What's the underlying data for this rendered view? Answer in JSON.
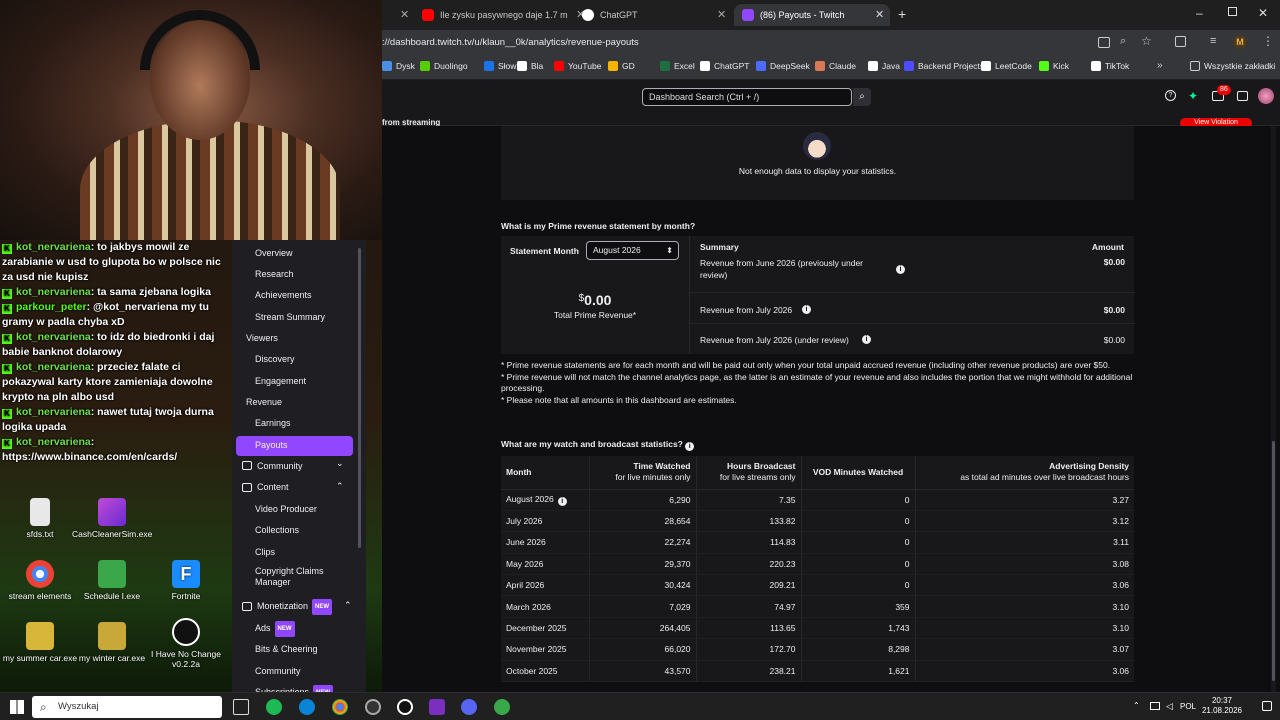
{
  "browser": {
    "tabs": [
      {
        "label": "Ile zysku pasywnego daje 1.7 m",
        "icon": "youtube-icon"
      },
      {
        "label": "ChatGPT",
        "icon": "chatgpt-icon"
      },
      {
        "label": "(86) Payouts - Twitch",
        "icon": "twitch-icon"
      }
    ],
    "url": "://dashboard.twitch.tv/u/klaun__0k/analytics/revenue-payouts",
    "bookmarks": [
      "Dysk",
      "Duolingo",
      "Słownik",
      "Bla",
      "YouTube",
      "GD",
      "Excel",
      "ChatGPT",
      "DeepSeek",
      "Claude",
      "Java",
      "Backend Projects",
      "LeetCode",
      "Kick",
      "TikTok"
    ],
    "all_bookmarks": "Wszystkie zakładki",
    "profile_initial": "M"
  },
  "twitch": {
    "search_placeholder": "Dashboard Search (Ctrl + /)",
    "notif_count": "86",
    "partial_text": "from streaming",
    "violation": "View Violation"
  },
  "chat": [
    {
      "user": "kot_nervariena",
      "text": "to jakbys mowil ze zarabianie w usd to glupota bo w polsce nic za usd nie kupisz"
    },
    {
      "user": "kot_nervariena",
      "text": "ta sama zjebana logika"
    },
    {
      "user": "parkour_peter",
      "text": "@kot_nervariena my tu gramy w padla chyba xD"
    },
    {
      "user": "kot_nervariena",
      "text": "to idz do biedronki i daj babie banknot dolarowy"
    },
    {
      "user": "kot_nervariena",
      "text": "przeciez falate ci pokazywal karty ktore zamieniaja dowolne krypto na pln albo usd"
    },
    {
      "user": "kot_nervariena",
      "text": "nawet tutaj twoja durna logika upada"
    },
    {
      "user": "kot_nervariena",
      "text": "https://www.binance.com/en/cards/"
    }
  ],
  "desktop_icons": [
    "sfds.txt",
    "CashCleanerSim.exe",
    "stream elements",
    "Schedule I.exe",
    "Fortnite",
    "my summer car.exe",
    "my winter car.exe",
    "I Have No Change v0.2.2a"
  ],
  "sidebar": {
    "items": [
      "Overview",
      "Research",
      "Achievements",
      "Stream Summary"
    ],
    "viewers": "Viewers",
    "viewer_items": [
      "Discovery",
      "Engagement"
    ],
    "revenue": "Revenue",
    "revenue_items": [
      "Earnings",
      "Payouts"
    ],
    "community": "Community",
    "content": "Content",
    "content_items": [
      "Video Producer",
      "Collections",
      "Clips",
      "Copyright Claims Manager"
    ],
    "monetization": "Monetization",
    "new_badge": "NEW",
    "monetization_items": [
      "Ads",
      "Bits & Cheering",
      "Community",
      "Subscriptions"
    ]
  },
  "main": {
    "no_data": "Not enough data to display your statistics.",
    "prime_question": "What is my Prime revenue statement by month?",
    "statement_month_label": "Statement Month",
    "statement_month_value": "August 2026",
    "total_currency": "$",
    "total_value": "0.00",
    "total_label": "Total Prime Revenue*",
    "summary_header": "Summary",
    "amount_header": "Amount",
    "summary_rows": [
      {
        "label": "Revenue from June 2026 (previously under review)",
        "amount": "$0.00"
      },
      {
        "label": "Revenue from July 2026",
        "amount": "$0.00"
      },
      {
        "label": "Revenue from July 2026 (under review)",
        "amount": "$0.00"
      }
    ],
    "notes": [
      "* Prime revenue statements are for each month and will be paid out only when your total unpaid accrued revenue (including other revenue products) are over $50.",
      "* Prime revenue will not match the channel analytics page, as the latter is an estimate of your revenue and also includes the portion that we might withhold for additional processing.",
      "* Please note that all amounts in this dashboard are estimates."
    ],
    "watch_question": "What are my watch and broadcast statistics?",
    "table": {
      "headers": [
        "Month",
        "Time Watched",
        "for live minutes only",
        "Hours Broadcast",
        "for live streams only",
        "VOD Minutes Watched",
        "Advertising Density",
        "as total ad minutes over live broadcast hours"
      ],
      "rows": [
        [
          "August 2026",
          "6,290",
          "7.35",
          "0",
          "3.27"
        ],
        [
          "July 2026",
          "28,654",
          "133.82",
          "0",
          "3.12"
        ],
        [
          "June 2026",
          "22,274",
          "114.83",
          "0",
          "3.11"
        ],
        [
          "May 2026",
          "29,370",
          "220.23",
          "0",
          "3.08"
        ],
        [
          "April 2026",
          "30,424",
          "209.21",
          "0",
          "3.06"
        ],
        [
          "March 2026",
          "7,029",
          "74.97",
          "359",
          "3.10"
        ],
        [
          "December 2025",
          "264,405",
          "113.65",
          "1,743",
          "3.10"
        ],
        [
          "November 2025",
          "66,020",
          "172.70",
          "8,298",
          "3.07"
        ],
        [
          "October 2025",
          "43,570",
          "238.21",
          "1,621",
          "3.06"
        ]
      ]
    }
  },
  "taskbar": {
    "search": "Wyszukaj",
    "lang": "POL",
    "time": "20:37",
    "date": "21.08.2026"
  }
}
